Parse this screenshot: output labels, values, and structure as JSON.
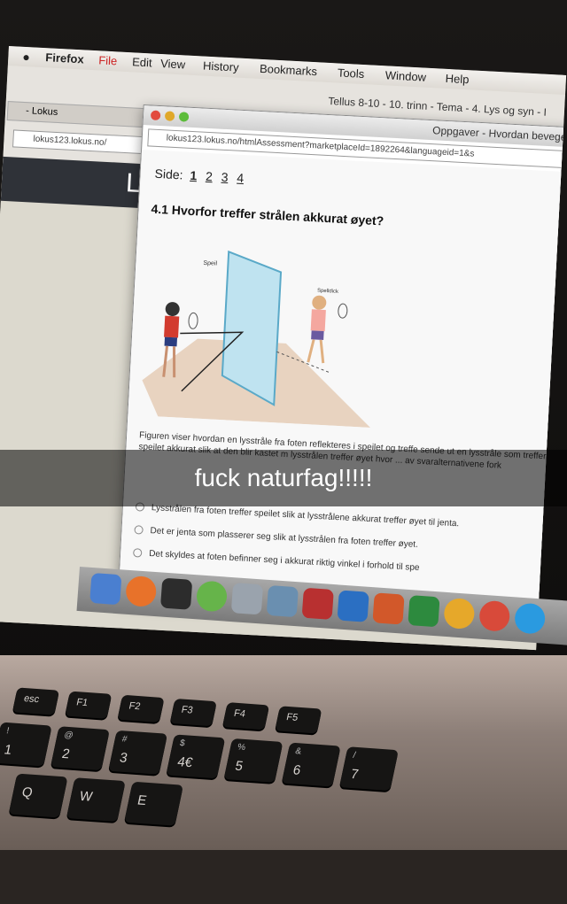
{
  "menubar": {
    "app": "Firefox",
    "items": [
      "File",
      "Edit",
      "View",
      "History",
      "Bookmarks",
      "Tools",
      "Window",
      "Help"
    ]
  },
  "back_window": {
    "title": "Tellus 8-10 - 10. trinn - Tema - 4. Lys og syn - I",
    "tab": "- Lokus",
    "url": "lokus123.lokus.no/"
  },
  "front_window": {
    "title": "Oppgaver - Hvordan beveger",
    "url": "lokus123.lokus.no/htmlAssessment?marketplaceId=1892264&languageid=1&s",
    "side_label": "Side:",
    "pages": [
      "1",
      "2",
      "3",
      "4"
    ],
    "question_title": "4.1 Hvorfor treffer strålen akkurat øyet?",
    "illustration_labels": {
      "mirror": "Speil",
      "shuttle": "Spelldick"
    },
    "paragraph": "Figuren viser hvordan en lysstråle fra foten reflekteres i speilet og treffe sende ut en lysstråle som treffer speilet akkurat slik at den blir kastet m lysstrålen treffer øyet hvor ... av svaralternativene fork",
    "options": [
      "Lysstrålen fra foten treffer speilet slik at lysstrålene akkurat treffer øyet til jenta.",
      "Det er jenta som plasserer seg slik at lysstrålen fra foten treffer øyet.",
      "Det skyldes at foten befinner seg i akkurat riktig vinkel i forhold til spe"
    ]
  },
  "caption": "fuck naturfag!!!!!",
  "keyboard": {
    "row1": [
      "esc",
      "F1",
      "F2",
      "F3",
      "F4",
      "F5"
    ],
    "row2": [
      "!",
      "@",
      "#",
      "$",
      "%",
      "&",
      "/"
    ],
    "row2_nums": [
      "1",
      "2",
      "3",
      "4€",
      "5",
      "6",
      "7"
    ],
    "row3": [
      "Q",
      "W",
      "E"
    ]
  },
  "colors": {
    "caption_bg": "#000000",
    "page_bg": "#f8f8f8",
    "dock": "#8d8d8d"
  }
}
